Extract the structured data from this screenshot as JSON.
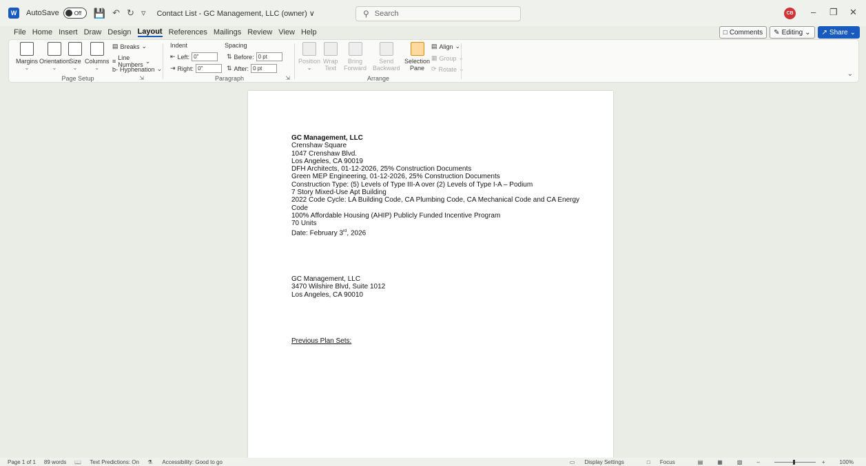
{
  "titlebar": {
    "app_letter": "W",
    "autosave_label": "AutoSave",
    "autosave_state": "Off",
    "doc_title": "Contact List - GC Management, LLC (owner) ∨",
    "search_placeholder": "Search",
    "avatar_initials": "CB"
  },
  "menu": {
    "items": [
      "File",
      "Home",
      "Insert",
      "Draw",
      "Design",
      "Layout",
      "References",
      "Mailings",
      "Review",
      "View",
      "Help"
    ],
    "active": "Layout",
    "comments": "Comments",
    "editing": "Editing",
    "share": "Share"
  },
  "ribbon": {
    "page_setup": {
      "label": "Page Setup",
      "margins": "Margins",
      "orientation": "Orientation",
      "size": "Size",
      "columns": "Columns",
      "breaks": "Breaks",
      "line_numbers": "Line Numbers",
      "hyphenation": "Hyphenation"
    },
    "paragraph": {
      "label": "Paragraph",
      "indent_title": "Indent",
      "spacing_title": "Spacing",
      "left_label": "Left:",
      "left_value": "0\"",
      "right_label": "Right:",
      "right_value": "0\"",
      "before_label": "Before:",
      "before_value": "0 pt",
      "after_label": "After:",
      "after_value": "0 pt"
    },
    "arrange": {
      "label": "Arrange",
      "position": "Position",
      "wrap_text_1": "Wrap",
      "wrap_text_2": "Text",
      "bring_forward_1": "Bring",
      "bring_forward_2": "Forward",
      "send_backward_1": "Send",
      "send_backward_2": "Backward",
      "selection_pane_1": "Selection",
      "selection_pane_2": "Pane",
      "align": "Align",
      "group": "Group",
      "rotate": "Rotate"
    }
  },
  "document": {
    "heading": "GC Management, LLC",
    "lines": [
      "Crenshaw Square",
      "1047 Crenshaw Blvd.",
      "Los Angeles, CA 90019",
      "DFH Architects, 01-12-2026, 25% Construction Documents",
      "Green MEP Engineering, 01-12-2026, 25% Construction Documents",
      "Construction Type: (5) Levels of Type III-A over (2) Levels of Type I-A – Podium",
      "7 Story Mixed-Use Apt Building",
      "2022 Code Cycle: LA Building Code, CA Plumbing Code, CA Mechanical Code and CA Energy",
      "Code",
      "100% Affordable Housing (AHIP) Publicly Funded Incentive Program",
      "70 Units"
    ],
    "date_prefix": "Date: February 3",
    "date_sup": "rd",
    "date_suffix": ", 2026",
    "address_block": [
      "GC Management, LLC",
      "3470 Wilshire Blvd, Suite 1012",
      "Los Angeles, CA 90010"
    ],
    "previous_plan_sets": "Previous Plan Sets:"
  },
  "status": {
    "page": "Page 1 of 1",
    "words": "89 words",
    "text_predictions": "Text Predictions: On",
    "accessibility": "Accessibility: Good to go",
    "display_settings": "Display Settings",
    "focus": "Focus",
    "zoom": "100%"
  }
}
